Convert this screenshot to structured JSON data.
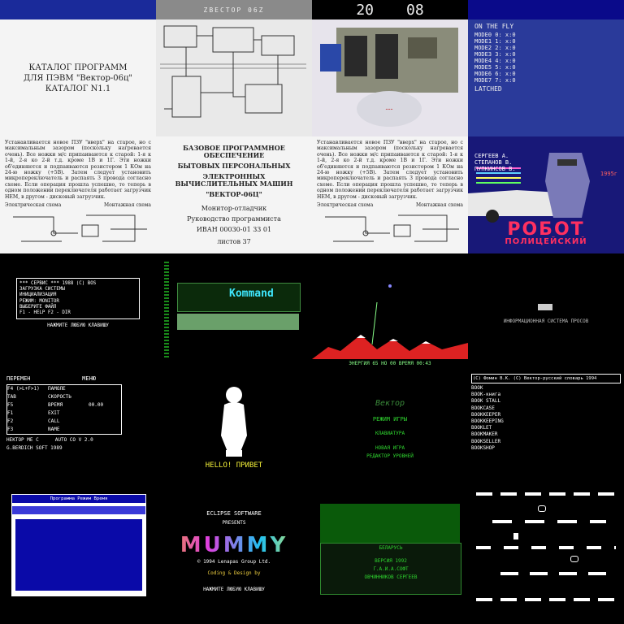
{
  "tiles": {
    "t00": {
      "text": ""
    },
    "t01": {
      "text": "ZBECTOP 06Z"
    },
    "t02": {
      "year_left": "20",
      "year_right": "08"
    },
    "t03": {
      "text": ""
    },
    "catalog": {
      "line1": "КАТАЛОГ ПРОГРАММ",
      "line2": "ДЛЯ ПЭВМ \"Вектор-06ц\"",
      "line3": "КАТАЛОГ N1.1"
    },
    "schematic": {
      "label": ""
    },
    "photo": {
      "label": ""
    },
    "listing": {
      "title1": "ON THE FLY",
      "title2": "LATCHED",
      "rows": [
        "MODE0 0: x:0",
        "MODE1 1: x:0",
        "MODE2 2: x:0",
        "MODE3 3: x:0",
        "MODE4 4: x:0",
        "MODE5 5: x:0",
        "MODE6 6: x:0",
        "MODE7 7: x:0"
      ]
    },
    "manual": {
      "para": "Устанавливается новое ПЗУ \"вверх\" на старое, но с максимальным зазором (поскольку нагревается очень). Все ножки м/с припаиваются к старой: 1-я к 1-й, 2-я ко 2-й т.д. кроме 1В и 1Г. Эти ножки об'единяются и подпаиваются резистором 1 КОм на 24-ю ножку (+5В). Затем следует установить микропереключатель и распаять 3 провода согласно схеме. Если операция прошла успешно, то теперь в одном положении переключателя работает загрузчик НЕМ, в другом - дисковый загрузчик.",
      "caption_left": "Электрическая схема",
      "caption_right": "Монтажная схема"
    },
    "doc": {
      "l1": "БАЗОВОЕ ПРОГРАММНОЕ ОБЕСПЕЧЕНИЕ",
      "l2": "БЫТОВЫХ ПЕРСОНАЛЬНЫХ",
      "l3": "ЭЛЕКТРОННЫХ ВЫЧИСЛИТЕЛЬНЫХ МАШИН",
      "l4": "\"ВЕКТОР-06Ц\"",
      "l5": "Монитор-отладчик",
      "l6": "Руководство программиста",
      "l7": "ИВАН 00030-01 33 01",
      "l8": "листов 37"
    },
    "manual2": {
      "caption_left": "Электрическая схема",
      "caption_right": "Монтажная схема"
    },
    "robot": {
      "credits": "СЕРГЕЕВ А. СТЕПАНОВ В. ПУПКИНСОВ В.",
      "title1": "РОБОТ",
      "title2": "ПОЛИЦЕЙСКИЙ",
      "year": "1995г"
    },
    "screen1": {
      "lines": [
        "*** СЕРВИС  ***  1988 (С) BOS",
        "ЗАГРУЗКА СИСТЕМЫ",
        "ИНИЦИАЛИЗАЦИЯ",
        "РЕЖИМ:  MONITOR",
        "ВЫБЕРИТЕ ФАЙЛ",
        "F1 - HELP   F2 - DIR",
        "НАЖМИТЕ ЛЮБУЮ КЛАВИШУ"
      ]
    },
    "screen2": {
      "title": "Kommand"
    },
    "screen3": {
      "hud": "ЭНЕРГИЯ 65     НО 00     ВРЕМЯ 00:43"
    },
    "screen4": {
      "line1": "ИНФОРМАЦИОННАЯ СИСТЕМА ПРОСОВ"
    },
    "menu": {
      "header_left": "ПЕРЕМЕН",
      "header_right": "МЕНЮ",
      "rows": [
        {
          "k": "F4 (>L+F>1)",
          "v": "ПАМОЛЕ"
        },
        {
          "k": "TAB",
          "v": "СКОРОСТЬ"
        },
        {
          "k": "F5",
          "v": "ВРЕМЯ",
          "n": "00.00"
        },
        {
          "k": "F1",
          "v": "EXIT"
        },
        {
          "k": "F2",
          "v": "CALL"
        },
        {
          "k": "F3",
          "v": "NAME"
        }
      ],
      "footer1": "НЕКТОР МЕ С",
      "footer2": "AUTO CO V 2.0",
      "footer3": "G.BERDICH    SOFT    1989"
    },
    "hello": {
      "text": "HELLO! ПРИВЕТ"
    },
    "green_menu": {
      "title": "Вектор",
      "item1": "РЕЖИМ ИГРЫ",
      "item2": "КЛАВИАТУРА",
      "item3": "НОВАЯ ИГРА",
      "item4": "РЕДАКТОР УРОВНЕЙ"
    },
    "dict": {
      "head": "(С) Фомин В.К.   (С) Вектор-русский словарь   1994",
      "lines": [
        "BOOK",
        "BOOK-книга",
        "BOOK STALL",
        "BOOKCASE",
        "BOOKKEEPER",
        "BOOKKEEPING",
        "BOOKLET",
        "BOOKMAKER",
        "BOOKSELLER",
        "BOOKSHOP"
      ]
    },
    "filemgr": {
      "title": "Программа    Режим    Время",
      "footer": ""
    },
    "mummy": {
      "brand": "ECLIPSE SOFTWARE",
      "presents": "PRESENTS",
      "title": "MUMMY",
      "copy": "© 1994 Lenapas Group Ltd.",
      "credit": "Coding & Design by",
      "prompt": "НАЖМИТЕ ЛЮБУЮ КЛАВИШУ"
    },
    "belarus": {
      "l1": "БЕЛАРУСЬ",
      "l2": "ВЕРСИЯ 1992",
      "l3": "Г.А.И.А.СОФТ",
      "l4": "ОВЧИННИКОВ СЕРГЕЕВ"
    },
    "platform": {
      "label": ""
    }
  }
}
